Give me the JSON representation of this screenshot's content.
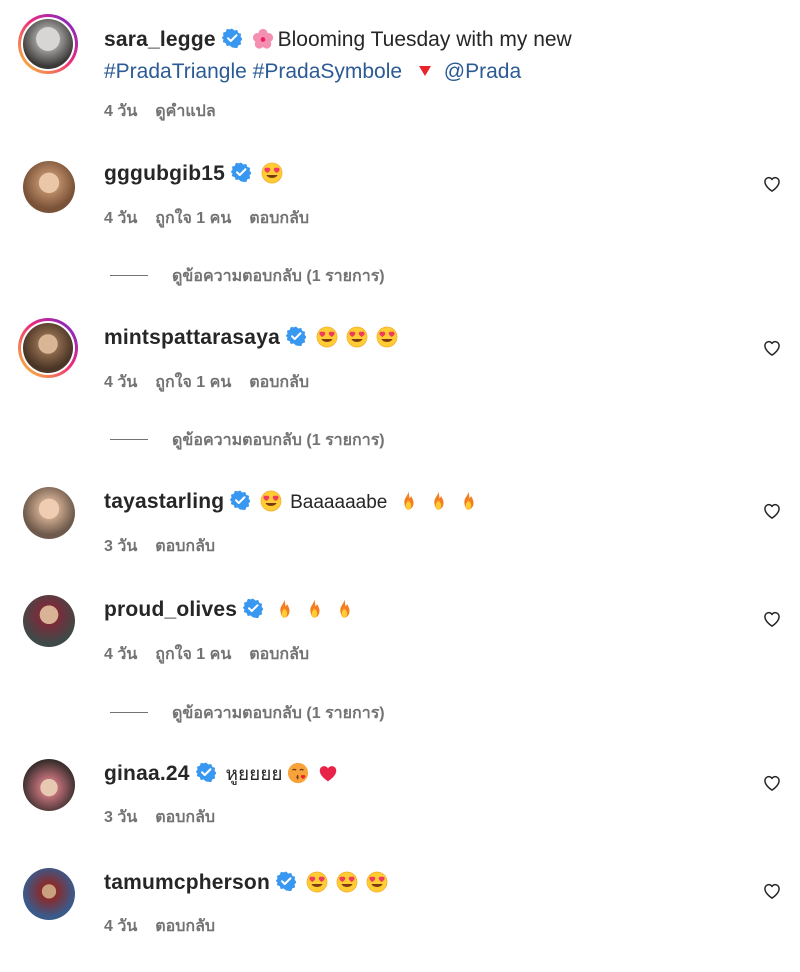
{
  "caption": {
    "username": "sara_legge",
    "text_line1": "Blooming Tuesday with my new",
    "hashtag1": "#PradaTriangle",
    "hashtag2": "#PradaSymbole",
    "mention": "@Prada",
    "time": "4 วัน",
    "translate": "ดูคำแปล"
  },
  "comments": [
    {
      "username": "gggubgib15",
      "time": "4 วัน",
      "likes": "ถูกใจ 1 คน",
      "reply": "ตอบกลับ",
      "view_replies": "ดูข้อความตอบกลับ (1 รายการ)"
    },
    {
      "username": "mintspattarasaya",
      "time": "4 วัน",
      "likes": "ถูกใจ 1 คน",
      "reply": "ตอบกลับ",
      "view_replies": "ดูข้อความตอบกลับ (1 รายการ)"
    },
    {
      "username": "tayastarling",
      "text": "Baaaaaabe",
      "time": "3 วัน",
      "reply": "ตอบกลับ"
    },
    {
      "username": "proud_olives",
      "time": "4 วัน",
      "likes": "ถูกใจ 1 คน",
      "reply": "ตอบกลับ",
      "view_replies": "ดูข้อความตอบกลับ (1 รายการ)"
    },
    {
      "username": "ginaa.24",
      "text": "หูยยยย",
      "time": "3 วัน",
      "reply": "ตอบกลับ"
    },
    {
      "username": "tamumcpherson",
      "time": "4 วัน",
      "reply": "ตอบกลับ"
    }
  ],
  "icons": {
    "verified": "verified-badge-icon",
    "heart": "heart-outline-icon",
    "heart_eyes": "heart-eyes-emoji",
    "fire": "fire-emoji",
    "flower": "cherry-blossom-emoji",
    "triangle": "red-triangle-emoji",
    "kiss": "kiss-emoji",
    "heart_red": "red-heart-emoji"
  },
  "colors": {
    "verified": "#3897f0",
    "hashtag": "#2b5a94",
    "meta": "#737373"
  }
}
